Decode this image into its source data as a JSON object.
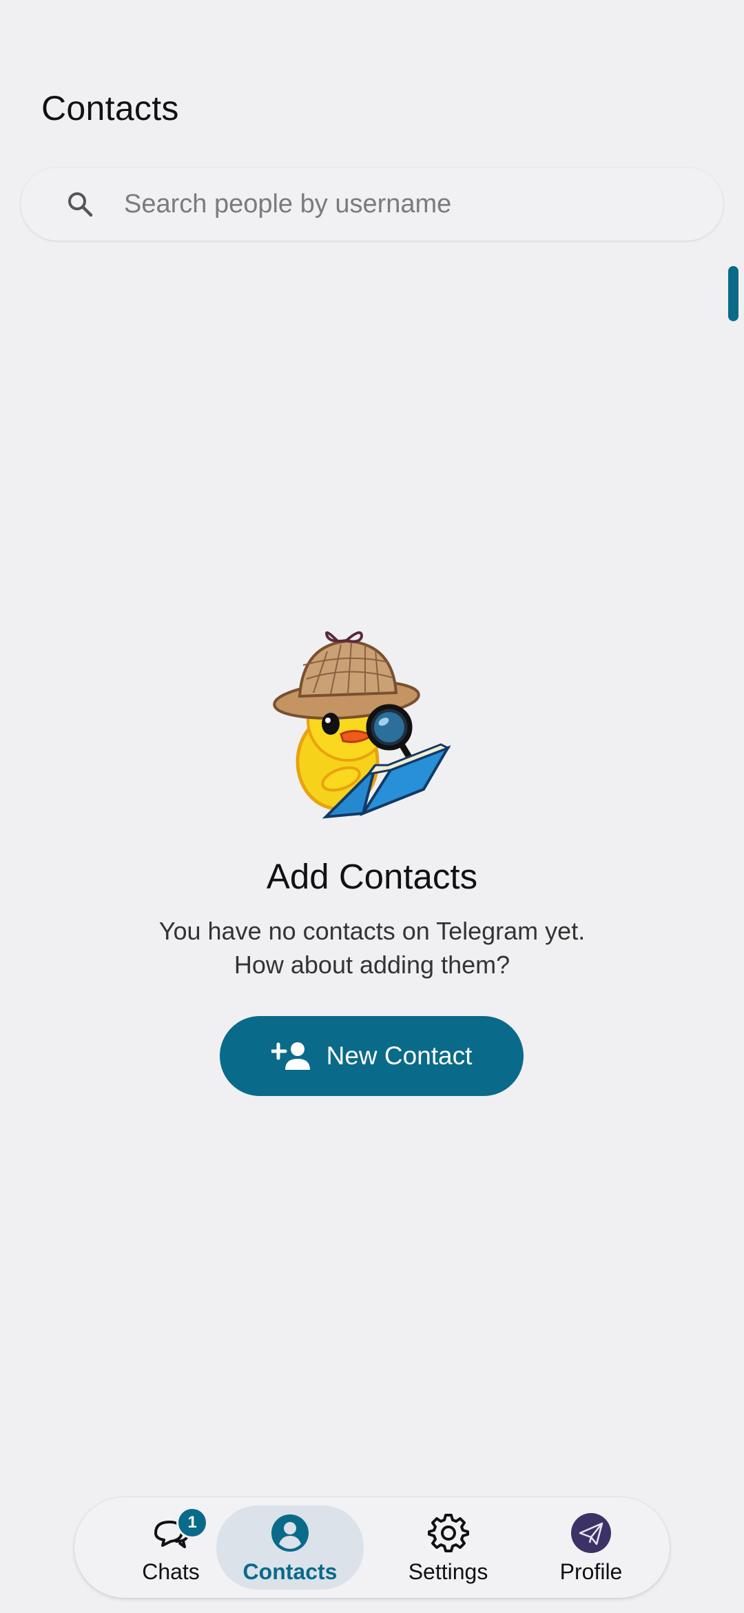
{
  "header": {
    "title": "Contacts"
  },
  "search": {
    "placeholder": "Search people by username",
    "value": ""
  },
  "empty_state": {
    "title": "Add Contacts",
    "line1": "You have no contacts on Telegram yet.",
    "line2": "How about adding them?",
    "button_label": "New Contact",
    "sticker": "duck-detective-sticker"
  },
  "bottom_nav": {
    "items": [
      {
        "label": "Chats",
        "icon": "chat-bubbles-icon",
        "badge": "1",
        "active": false
      },
      {
        "label": "Contacts",
        "icon": "person-circle-icon",
        "active": true
      },
      {
        "label": "Settings",
        "icon": "gear-icon",
        "active": false
      },
      {
        "label": "Profile",
        "icon": "paper-plane-avatar-icon",
        "active": false
      }
    ]
  },
  "colors": {
    "accent": "#0a6a8a",
    "background": "#f0f0f3",
    "active_tab_bg": "#dbe2ea"
  }
}
